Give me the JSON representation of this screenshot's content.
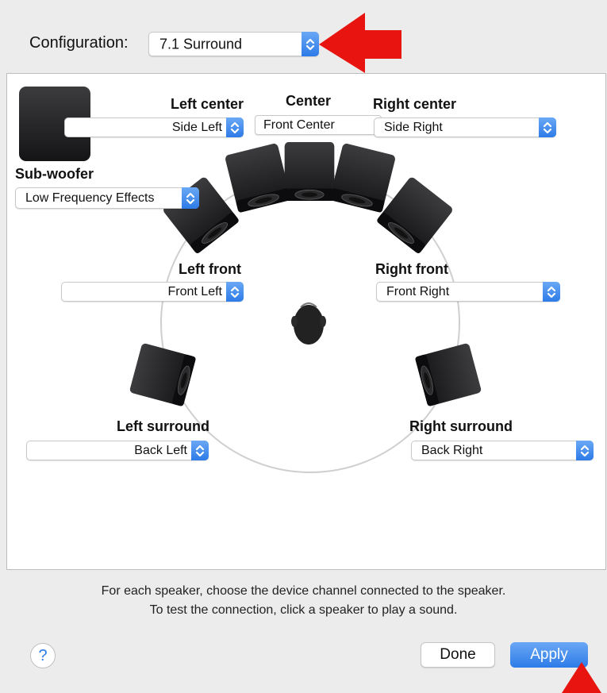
{
  "configuration": {
    "label": "Configuration:",
    "value": "7.1 Surround"
  },
  "speakers": {
    "left_center": {
      "label": "Left center",
      "value": "Side Left"
    },
    "center": {
      "label": "Center",
      "value": "Front Center"
    },
    "right_center": {
      "label": "Right center",
      "value": "Side Right"
    },
    "subwoofer": {
      "label": "Sub-woofer",
      "value": "Low Frequency Effects"
    },
    "left_front": {
      "label": "Left front",
      "value": "Front Left"
    },
    "right_front": {
      "label": "Right front",
      "value": "Front Right"
    },
    "left_surround": {
      "label": "Left surround",
      "value": "Back Left"
    },
    "right_surround": {
      "label": "Right surround",
      "value": "Back Right"
    }
  },
  "instructions": {
    "line1": "For each speaker, choose the device channel connected to the speaker.",
    "line2": "To test the connection, click a speaker to play a sound."
  },
  "buttons": {
    "help": "?",
    "done": "Done",
    "apply": "Apply"
  },
  "colors": {
    "accent": "#2d7be8",
    "annotation_arrow": "#e8140f"
  }
}
